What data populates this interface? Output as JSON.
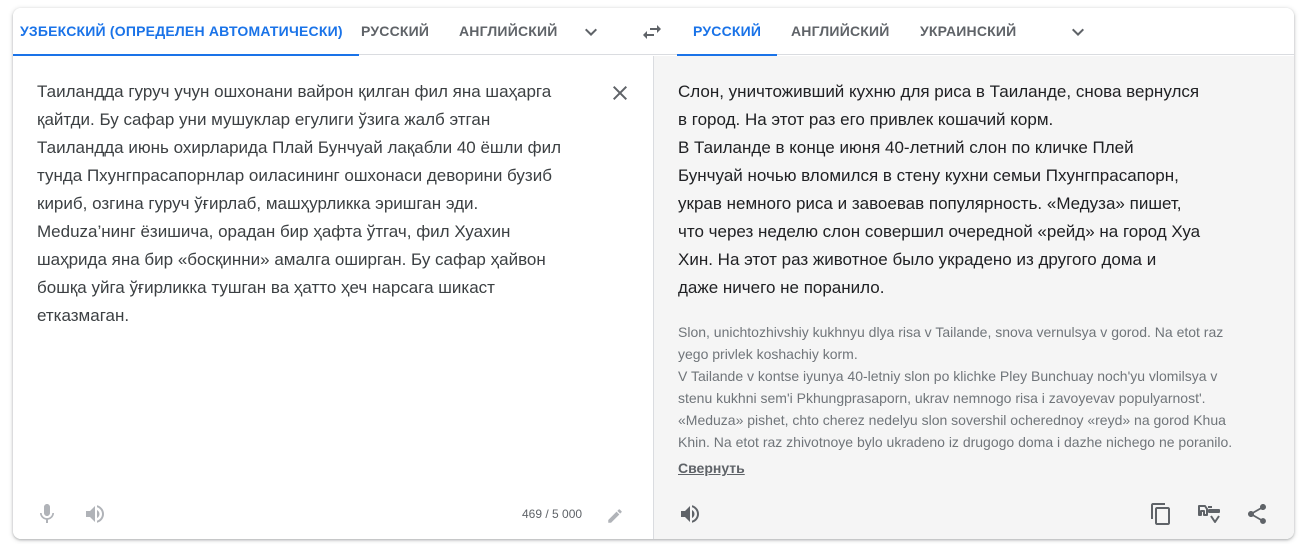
{
  "source_langs": {
    "detected": "УЗБЕКСКИЙ (ОПРЕДЕЛЕН АВТОМАТИЧЕСКИ)",
    "opt1": "РУССКИЙ",
    "opt2": "АНГЛИЙСКИЙ"
  },
  "target_langs": {
    "opt1": "РУССКИЙ",
    "opt2": "АНГЛИЙСКИЙ",
    "opt3": "УКРАИНСКИЙ"
  },
  "source": {
    "text": "Таиландда гуруч учун ошхонани вайрон қилган фил яна шаҳарга\nқайтди. Бу сафар уни мушуклар егулиги ўзига жалб этган\nТаиландда июнь охирларида Плай Бунчуай лақабли 40 ёшли фил\nтунда Пхунгпрасапорнлар оиласининг ошхонаси деворини бузиб\nкириб, озгина гуруч ўғирлаб, машҳурликка эришган эди.\nMeduza’нинг ёзишича, орадан бир ҳафта ўтгач, фил Хуахин\nшаҳрида яна бир «босқинни» амалга оширган. Бу сафар ҳайвон\nбошқа уйга ўғирликка тушган ва ҳатто ҳеч нарсага шикаст\nетказмаган.",
    "char_count": "469 / 5 000"
  },
  "target": {
    "text": "Слон, уничтоживший кухню для риса в Таиланде, снова вернулся\nв город. На этот раз его привлек кошачий корм.\nВ Таиланде в конце июня 40-летний слон по кличке Плей\nБунчуай ночью вломился в стену кухни семьи Пхунгпрасапорн,\nукрав немного риса и завоевав популярность. «Медуза» пишет,\nчто через неделю слон совершил очередной «рейд» на город Хуа\nХин. На этот раз животное было украдено из другого дома и\nдаже ничего не поранило.",
    "transliteration": "Slon, unichtozhivshiy kukhnyu dlya risa v Tailande, snova vernulsya v gorod. Na etot raz\nyego privlek koshachiy korm.\nV Tailande v kontse iyunya 40-letniy slon po klichke Pley Bunchuay noch'yu vlomilsya v\nstenu kukhni sem'i Pkhungprasaporn, ukrav nemnogo risa i zavoyevav populyarnost'.\n«Meduza» pishet, chto cherez nedelyu slon sovershil ocherednoy «reyd» na gorod Khua\nKhin. Na etot raz zhivotnoye bylo ukradeno iz drugogo doma i dazhe nichego ne poranilo.",
    "collapse_label": "Свернуть"
  },
  "colors": {
    "accent": "#1a73e8",
    "icon": "#5f6368",
    "target_bg": "#f5f5f5"
  },
  "icons": [
    "chevron-down-icon",
    "swap-icon",
    "close-icon",
    "microphone-icon",
    "speaker-icon",
    "pencil-icon",
    "copy-icon",
    "rate-icon",
    "share-icon"
  ]
}
